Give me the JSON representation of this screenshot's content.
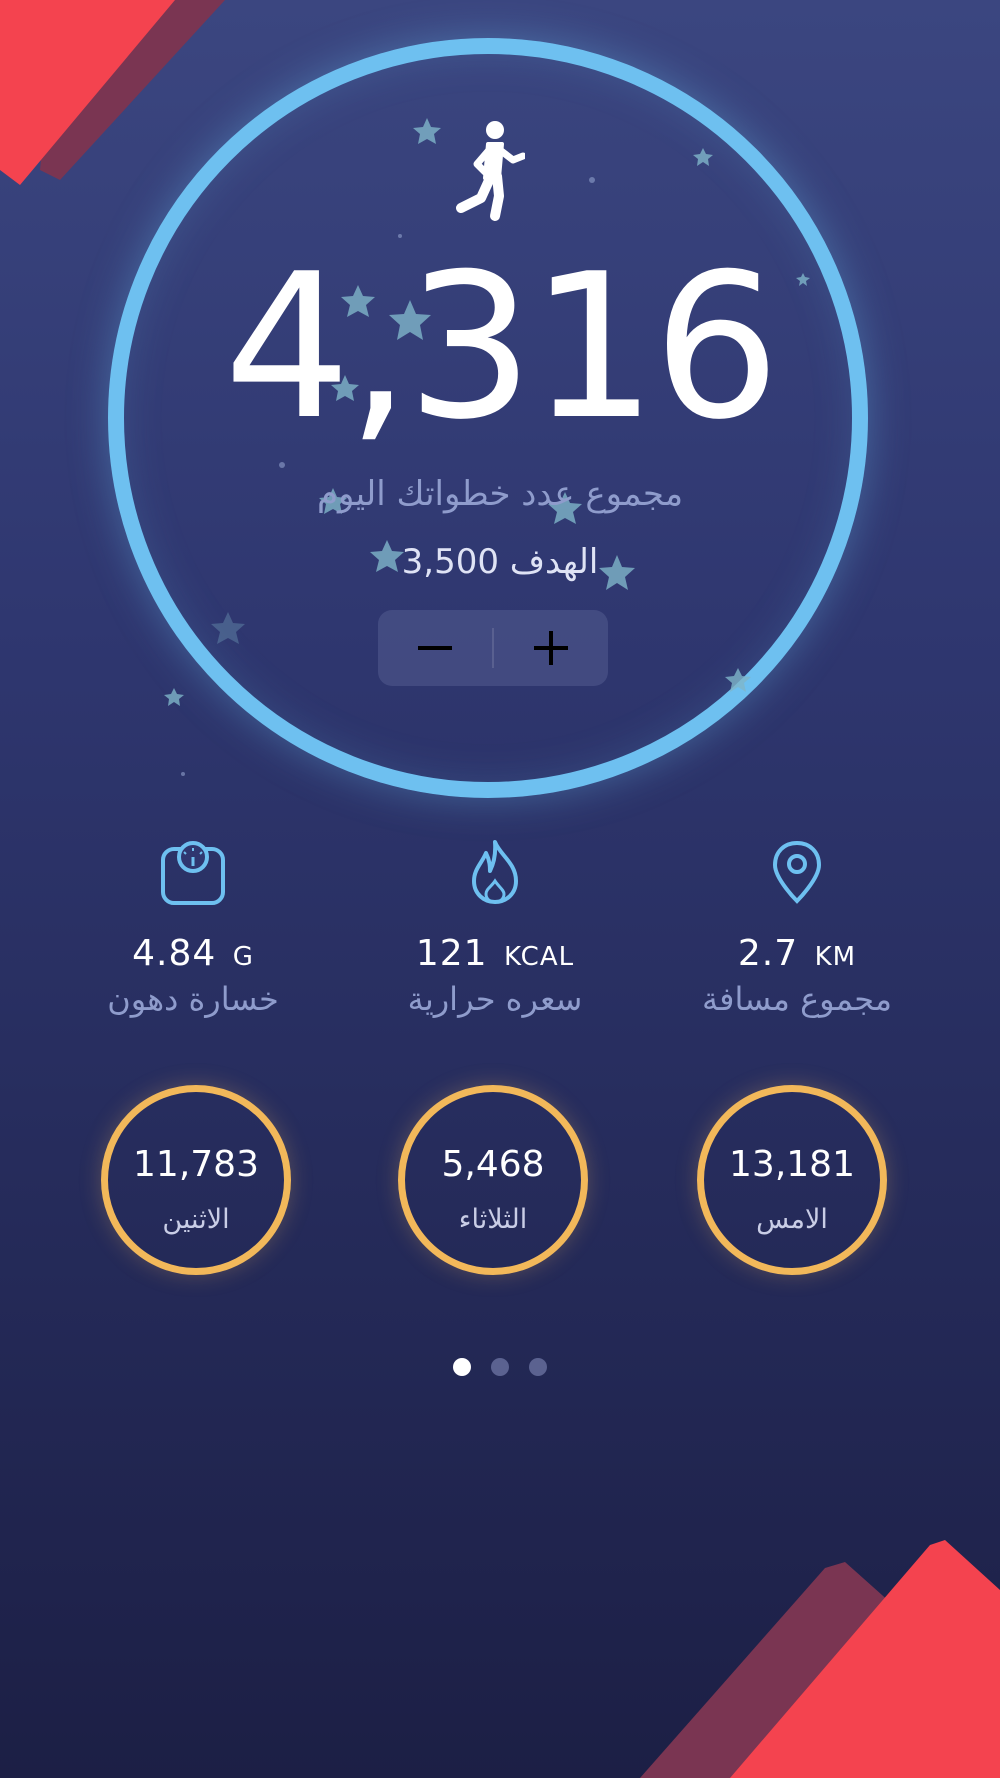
{
  "today": {
    "steps": "4,316",
    "steps_label": "مجموع عدد خطواتك اليوم",
    "goal_text": "الهدف 3,500"
  },
  "stepper": {
    "minus_symbol": "−",
    "plus_symbol": "+"
  },
  "stats": [
    {
      "icon": "location-pin-icon",
      "value": "2.7",
      "unit": "KM",
      "label": "مجموع مسافة"
    },
    {
      "icon": "flame-icon",
      "value": "121",
      "unit": "KCAL",
      "label": "سعره حرارية"
    },
    {
      "icon": "scale-icon",
      "value": "4.84",
      "unit": "G",
      "label": "خسارة دهون"
    }
  ],
  "history": [
    {
      "value": "13,181",
      "label": "الامس"
    },
    {
      "value": "5,468",
      "label": "الثلاثاء"
    },
    {
      "value": "11,783",
      "label": "الاثنين"
    }
  ],
  "pagination": {
    "pages": 3,
    "active": 1
  },
  "colors": {
    "ring": "#6ec0f0",
    "history_ring": "#f2b85a",
    "accent_red": "#f4434f",
    "background_top": "#3b4680",
    "background_bottom": "#1c1f45"
  }
}
